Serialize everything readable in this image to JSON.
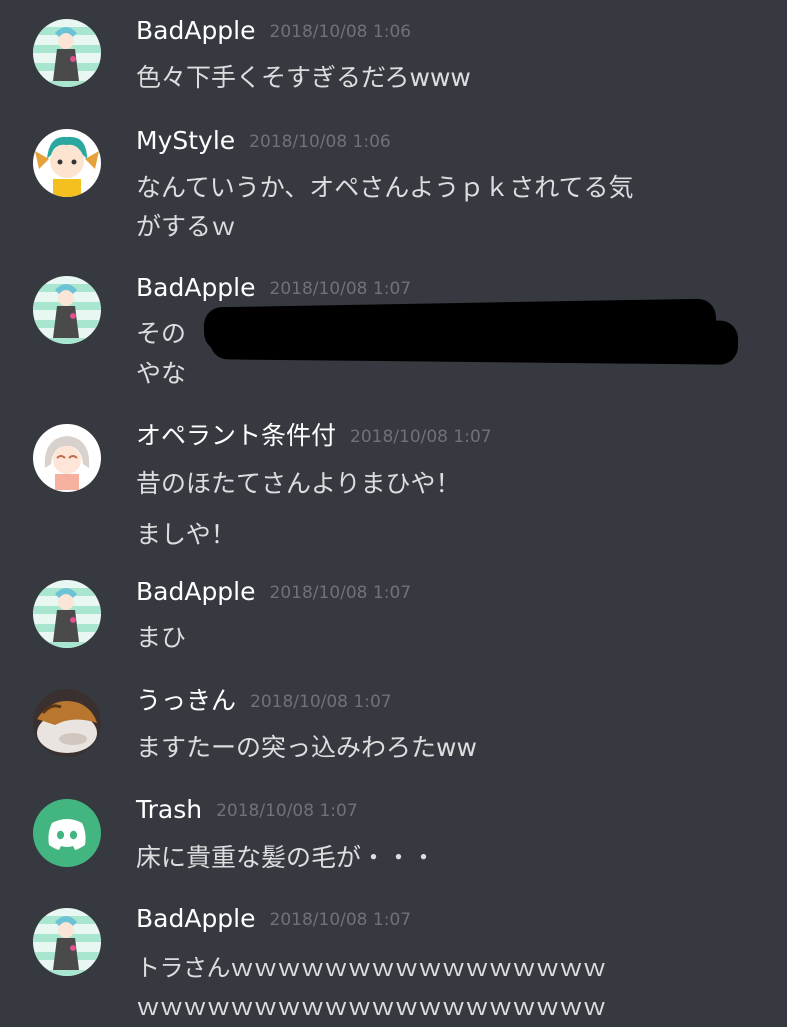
{
  "messages": [
    {
      "author": "BadApple",
      "timestamp": "2018/10/08 1:06",
      "avatar_icon": "badapple-avatar-icon",
      "lines": [
        "色々下手くそすぎるだろwww"
      ]
    },
    {
      "author": "MyStyle",
      "timestamp": "2018/10/08 1:06",
      "avatar_icon": "mystyle-avatar-icon",
      "lines": [
        "なんていうか、オペさんようｐｋされてる気",
        "がするｗ"
      ]
    },
    {
      "author": "BadApple",
      "timestamp": "2018/10/08 1:07",
      "avatar_icon": "badapple-avatar-icon",
      "lines": [
        "その",
        "やな"
      ]
    },
    {
      "author": "オペラント条件付",
      "timestamp": "2018/10/08 1:07",
      "avatar_icon": "operant-avatar-icon",
      "lines": [
        "昔のほたてさんよりまひや！",
        "ましや！"
      ]
    },
    {
      "author": "BadApple",
      "timestamp": "2018/10/08 1:07",
      "avatar_icon": "badapple-avatar-icon",
      "lines": [
        "まひ"
      ]
    },
    {
      "author": "うっきん",
      "timestamp": "2018/10/08 1:07",
      "avatar_icon": "ukkin-avatar-icon",
      "lines": [
        "ますたーの突っ込みわろたww"
      ]
    },
    {
      "author": "Trash",
      "timestamp": "2018/10/08 1:07",
      "avatar_icon": "discord-logo-icon",
      "lines": [
        "床に貴重な髪の毛が・・・"
      ]
    },
    {
      "author": "BadApple",
      "timestamp": "2018/10/08 1:07",
      "avatar_icon": "badapple-avatar-icon",
      "lines": [
        "トラさんｗｗｗｗｗｗｗｗｗｗｗｗｗｗｗｗ",
        "ｗｗｗｗｗｗｗｗｗｗｗｗｗｗｗｗｗｗｗｗ"
      ]
    }
  ],
  "colors": {
    "background": "#36393f",
    "author": "#ffffff",
    "timestamp": "#6f7278",
    "text": "#dcddde",
    "discord_green": "#43b581"
  }
}
